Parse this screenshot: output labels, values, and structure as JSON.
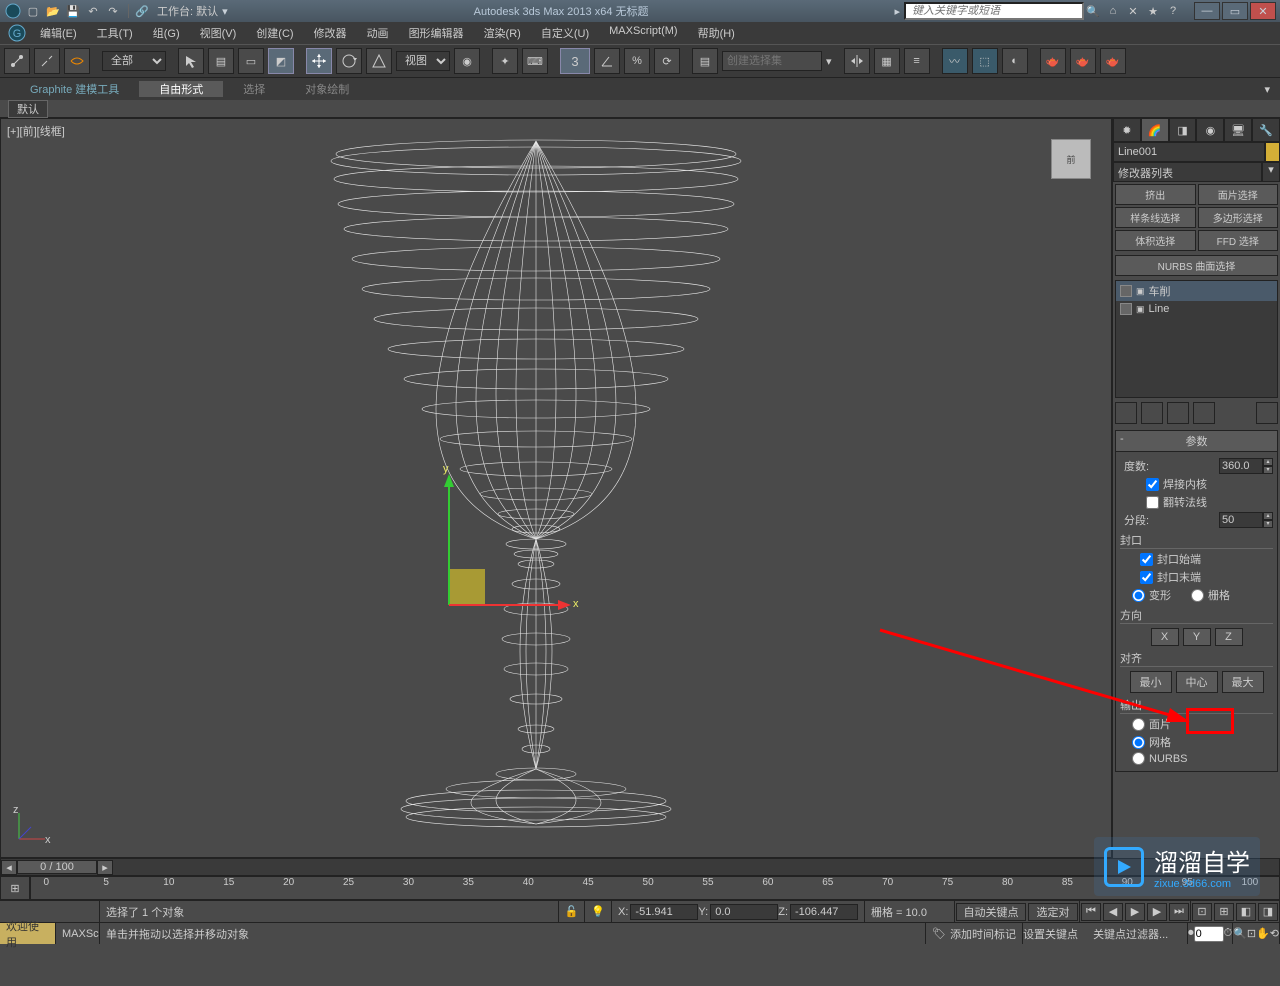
{
  "titlebar": {
    "workspace_label": "工作台: 默认",
    "app_title": "Autodesk 3ds Max  2013 x64    无标题",
    "search_placeholder": "键入关键字或短语"
  },
  "menubar": {
    "items": [
      "编辑(E)",
      "工具(T)",
      "组(G)",
      "视图(V)",
      "创建(C)",
      "修改器",
      "动画",
      "图形编辑器",
      "渲染(R)",
      "自定义(U)",
      "MAXScript(M)",
      "帮助(H)"
    ]
  },
  "toolbar": {
    "filter_all": "全部",
    "view_dropdown": "视图",
    "selset_placeholder": "创建选择集"
  },
  "ribbon": {
    "tabs": [
      "Graphite 建模工具",
      "自由形式",
      "选择",
      "对象绘制"
    ],
    "active": 1,
    "strip_label": "默认"
  },
  "viewport": {
    "label": "[+][前][线框]",
    "viewcube_face": "前",
    "axis_x": "x",
    "axis_y": "y",
    "axis_z": "z"
  },
  "command_panel": {
    "object_name": "Line001",
    "modifier_list_label": "修改器列表",
    "buttons": {
      "extrude": "挤出",
      "face_sel": "面片选择",
      "spline_sel": "样条线选择",
      "poly_sel": "多边形选择",
      "vol_sel": "体积选择",
      "ffd_sel": "FFD 选择",
      "nurbs_surf": "NURBS 曲面选择"
    },
    "stack": {
      "lathe": "车削",
      "line": "Line"
    },
    "rollout_title": "参数",
    "params": {
      "degrees_label": "度数:",
      "degrees_value": "360.0",
      "weld_core": "焊接内核",
      "flip_normals": "翻转法线",
      "segments_label": "分段:",
      "segments_value": "50",
      "capping_label": "封口",
      "cap_start": "封口始端",
      "cap_end": "封口末端",
      "morph": "变形",
      "grid": "栅格",
      "direction_label": "方向",
      "dir_x": "X",
      "dir_y": "Y",
      "dir_z": "Z",
      "align_label": "对齐",
      "align_min": "最小",
      "align_center": "中心",
      "align_max": "最大",
      "output_label": "输出",
      "out_patch": "面片",
      "out_mesh": "网格",
      "out_nurbs": "NURBS"
    }
  },
  "timeline": {
    "slider_label": "0 / 100",
    "ticks": [
      "0",
      "5",
      "10",
      "15",
      "20",
      "25",
      "30",
      "35",
      "40",
      "45",
      "50",
      "55",
      "60",
      "65",
      "70",
      "75",
      "80",
      "85",
      "90",
      "95",
      "100"
    ]
  },
  "statusbar": {
    "sel_text": "选择了 1 个对象",
    "x_label": "X:",
    "x_val": "-51.941",
    "y_label": "Y:",
    "y_val": "0.0",
    "z_label": "Z:",
    "z_val": "-106.447",
    "grid_label": "栅格 = 10.0",
    "autokey": "自动关键点",
    "selkey": "选定对",
    "welcome": "欢迎使用",
    "maxscript": "MAXSc",
    "prompt": "单击并拖动以选择并移动对象",
    "add_time_tag": "添加时间标记",
    "set_key": "设置关键点",
    "key_filters": "关键点过滤器..."
  },
  "watermark": {
    "brand": "溜溜自学",
    "url": "zixue.3d66.com"
  }
}
